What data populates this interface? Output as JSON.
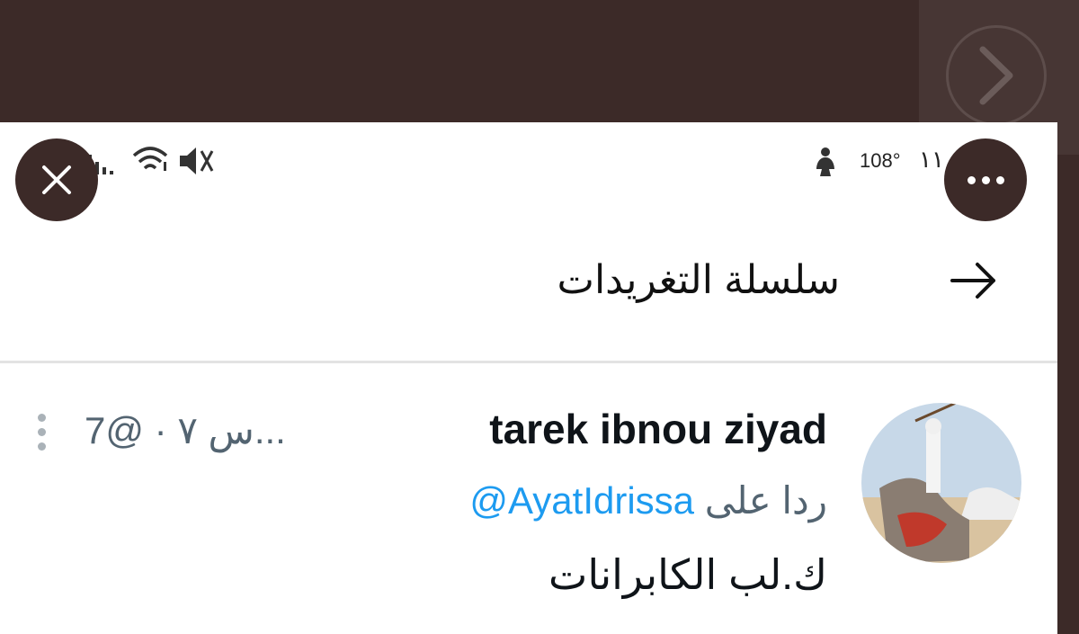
{
  "status_bar": {
    "temperature": "108°",
    "clock": "١١",
    "icons": [
      "signal-icon",
      "wifi-icon",
      "muted-speaker-icon",
      "accessibility-person-icon"
    ]
  },
  "header": {
    "title": "سلسلة التغريدات"
  },
  "tweet": {
    "author_name": "tarek ibnou ziyad",
    "meta": "س ٧ · @7...",
    "reply_prefix": "ردا على",
    "reply_mention": "@AyatIdrissa",
    "body": "ك.لب الكابرانات"
  },
  "colors": {
    "backdrop": "#3c2a28",
    "panel": "#ffffff",
    "mention": "#1d9bf0",
    "muted": "#536471"
  }
}
